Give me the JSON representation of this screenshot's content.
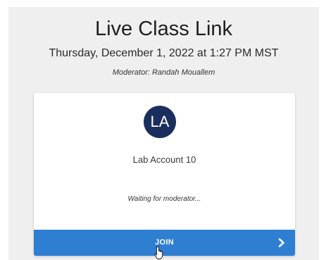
{
  "header": {
    "title": "Live Class Link",
    "datetime": "Thursday, December 1, 2022 at 1:27 PM MST",
    "moderator": "Moderator: Randah Mouallem"
  },
  "card": {
    "avatar_initials": "LA",
    "avatar_color": "#1b2f5e",
    "account_name": "Lab Account 10",
    "status": "Waiting for moderator...",
    "join_label": "JOIN",
    "join_color": "#2e7fd1",
    "join_icon": "chevron-right-icon"
  }
}
